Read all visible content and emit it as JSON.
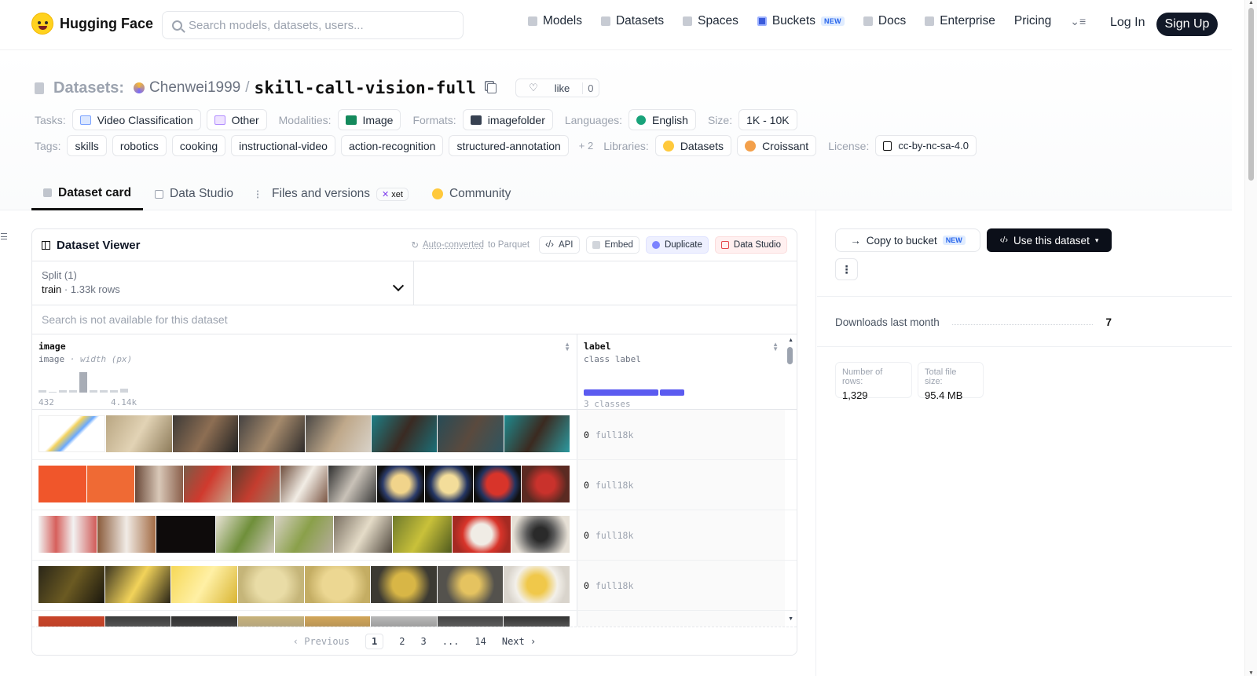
{
  "brand": "Hugging Face",
  "search": {
    "placeholder": "Search models, datasets, users..."
  },
  "nav": {
    "models": "Models",
    "datasets": "Datasets",
    "spaces": "Spaces",
    "buckets": "Buckets",
    "buckets_badge": "NEW",
    "docs": "Docs",
    "enterprise": "Enterprise",
    "pricing": "Pricing",
    "login": "Log In",
    "signup": "Sign Up"
  },
  "title": {
    "prefix": "Datasets:",
    "owner": "Chenwei1999",
    "separator": "/",
    "repo": "skill-call-vision-full",
    "like_label": "like",
    "like_count": "0"
  },
  "meta": {
    "tasks_label": "Tasks:",
    "tasks": [
      "Video Classification",
      "Other"
    ],
    "modalities_label": "Modalities:",
    "modalities": [
      "Image"
    ],
    "formats_label": "Formats:",
    "formats": [
      "imagefolder"
    ],
    "languages_label": "Languages:",
    "languages": [
      "English"
    ],
    "size_label": "Size:",
    "size": "1K - 10K",
    "tags_label": "Tags:",
    "tags": [
      "skills",
      "robotics",
      "cooking",
      "instructional-video",
      "action-recognition",
      "structured-annotation"
    ],
    "tags_more": "+ 2",
    "libraries_label": "Libraries:",
    "libraries": [
      "Datasets",
      "Croissant"
    ],
    "license_label": "License:",
    "license": "cc-by-nc-sa-4.0"
  },
  "tabs": {
    "dataset_card": "Dataset card",
    "data_studio": "Data Studio",
    "files": "Files and versions",
    "xet": "xet",
    "community": "Community"
  },
  "viewer": {
    "title": "Dataset Viewer",
    "auto_converted": "Auto-converted",
    "to_parquet": "to Parquet",
    "api": "API",
    "embed": "Embed",
    "duplicate": "Duplicate",
    "data_studio": "Data Studio",
    "split_label": "Split (1)",
    "split_name": "train",
    "split_dot": "·",
    "split_rows": "1.33k rows",
    "search_notice": "Search is not available for this dataset",
    "columns": {
      "image": {
        "name": "image",
        "type": "image",
        "sep": "·",
        "extra": "width (px)",
        "min": "432",
        "max": "4.14k"
      },
      "label": {
        "name": "label",
        "type": "class label",
        "classes": "3 classes"
      }
    },
    "rows": [
      {
        "label_idx": "0",
        "label_name": "full18k"
      },
      {
        "label_idx": "0",
        "label_name": "full18k"
      },
      {
        "label_idx": "0",
        "label_name": "full18k"
      },
      {
        "label_idx": "0",
        "label_name": "full18k"
      }
    ],
    "pager": {
      "prev": "Previous",
      "pages": [
        "1",
        "2",
        "3",
        "...",
        "14"
      ],
      "next": "Next"
    }
  },
  "sidebar": {
    "copy_bucket": "Copy to bucket",
    "copy_badge": "NEW",
    "use_dataset": "Use this dataset",
    "more": "⋮",
    "downloads_label": "Downloads last month",
    "downloads": "7",
    "rows_label": "Number of rows:",
    "rows_value": "1,329",
    "size_label": "Total file size:",
    "size_value": "95.4 MB"
  },
  "histogram": [
    0.1,
    0,
    0.1,
    0.1,
    1,
    0.1,
    0.1,
    0.1,
    0.2
  ],
  "label_distribution": [
    0.73,
    0.24
  ],
  "colors": {
    "accent": "#5b5bf0",
    "dark": "#111827"
  }
}
